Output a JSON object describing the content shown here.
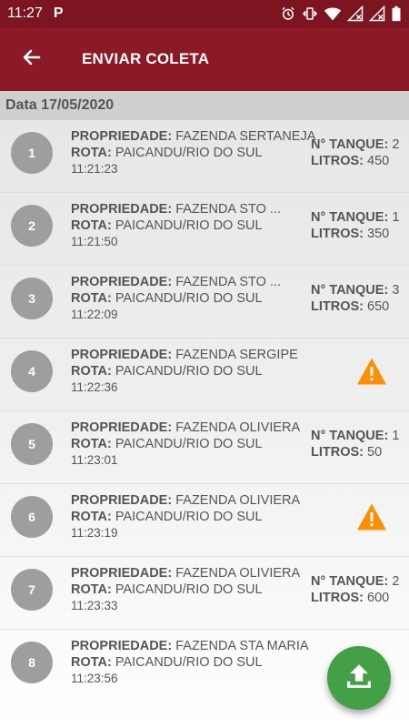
{
  "status_bar": {
    "time": "11:27",
    "app_icon": "P"
  },
  "app_bar": {
    "title": "ENVIAR COLETA",
    "back_icon": "arrow-left-icon"
  },
  "date_header": "Data 17/05/2020",
  "labels": {
    "propriedade": "PROPRIEDADE:",
    "rota": "ROTA:",
    "tanque": "N° TANQUE:",
    "litros": "LITROS:"
  },
  "items": [
    {
      "num": "1",
      "propriedade": "FAZENDA SERTANEJA",
      "rota": "PAICANDU/RIO DO SUL",
      "time": "11:21:23",
      "tanque": "2",
      "litros": "450",
      "warning": false
    },
    {
      "num": "2",
      "propriedade": "FAZENDA STO ...",
      "rota": "PAICANDU/RIO DO SUL",
      "time": "11:21:50",
      "tanque": "1",
      "litros": "350",
      "warning": false
    },
    {
      "num": "3",
      "propriedade": "FAZENDA STO ...",
      "rota": "PAICANDU/RIO DO SUL",
      "time": "11:22:09",
      "tanque": "3",
      "litros": "650",
      "warning": false
    },
    {
      "num": "4",
      "propriedade": "FAZENDA SERGIPE",
      "rota": "PAICANDU/RIO DO SUL",
      "time": "11:22:36",
      "tanque": "",
      "litros": "",
      "warning": true
    },
    {
      "num": "5",
      "propriedade": "FAZENDA OLIVIERA",
      "rota": "PAICANDU/RIO DO SUL",
      "time": "11:23:01",
      "tanque": "1",
      "litros": "50",
      "warning": false
    },
    {
      "num": "6",
      "propriedade": "FAZENDA OLIVIERA",
      "rota": "PAICANDU/RIO DO SUL",
      "time": "11:23:19",
      "tanque": "",
      "litros": "",
      "warning": true
    },
    {
      "num": "7",
      "propriedade": "FAZENDA OLIVIERA",
      "rota": "PAICANDU/RIO DO SUL",
      "time": "11:23:33",
      "tanque": "2",
      "litros": "600",
      "warning": false
    },
    {
      "num": "8",
      "propriedade": "FAZENDA STA MARIA",
      "rota": "PAICANDU/RIO DO SUL",
      "time": "11:23:56",
      "tanque": "",
      "litros": "",
      "warning": false
    }
  ],
  "fab": {
    "icon": "upload-icon"
  },
  "colors": {
    "status_bar": "#7d1520",
    "app_bar": "#8b1a26",
    "avatar": "#9e9e9e",
    "warning": "#ff8f00",
    "fab": "#43a047"
  }
}
